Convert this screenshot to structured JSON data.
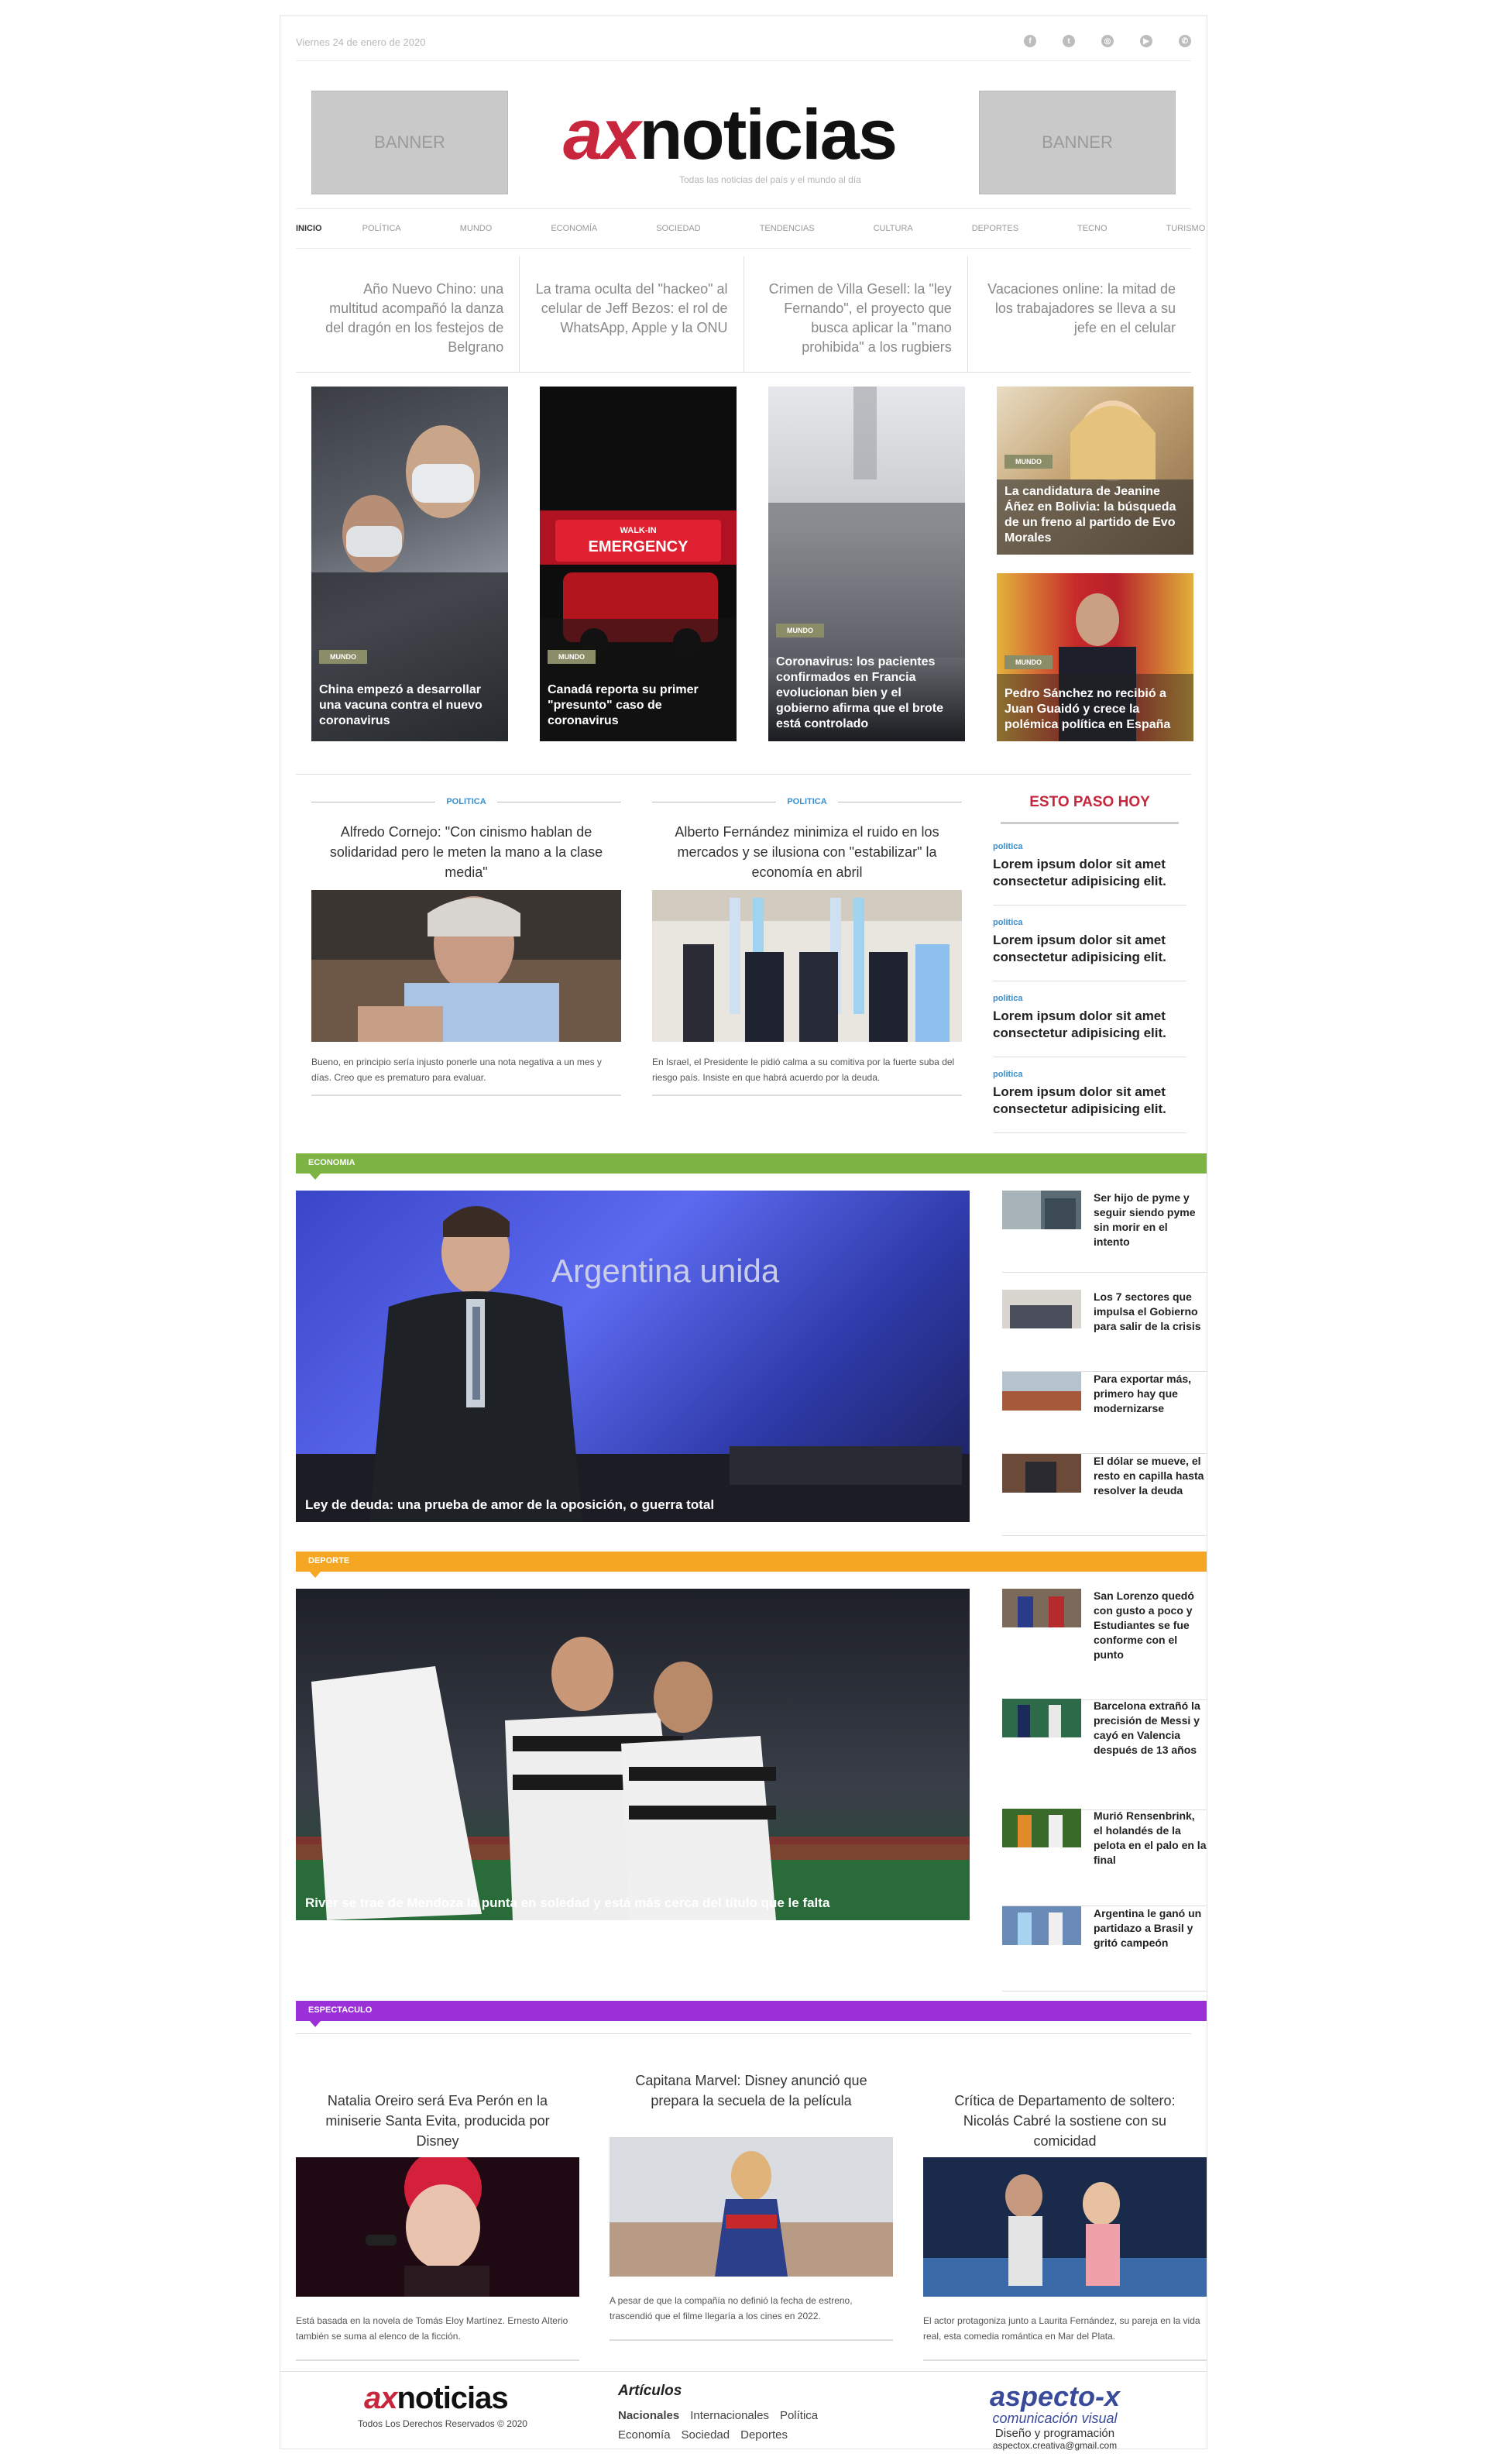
{
  "topbar": {
    "date": "Viernes 24 de enero de 2020",
    "socials": [
      {
        "icon": "facebook-icon",
        "glyph": "f"
      },
      {
        "icon": "twitter-icon",
        "glyph": "t"
      },
      {
        "icon": "instagram-icon",
        "glyph": "◎"
      },
      {
        "icon": "youtube-icon",
        "glyph": "▶"
      },
      {
        "icon": "whatsapp-icon",
        "glyph": "✆"
      }
    ]
  },
  "header": {
    "banner_left": "BANNER",
    "banner_right": "BANNER",
    "logo_ax": "ax",
    "logo_noticias": "noticias",
    "tagline": "Todas las noticias del país y el mundo al día"
  },
  "nav": [
    "INICIO",
    "POLÍTICA",
    "MUNDO",
    "ECONOMÍA",
    "SOCIEDAD",
    "TENDENCIAS",
    "CULTURA",
    "DEPORTES",
    "TECNO",
    "TURISMO"
  ],
  "headlines": [
    "Año Nuevo Chino: una multitud acompañó la danza del dragón en los festejos de Belgrano",
    "La trama oculta del \"hackeo\" al celular de Jeff Bezos: el rol de WhatsApp, Apple y la ONU",
    "Crimen de Villa Gesell: la \"ley Fernando\", el proyecto que busca aplicar la \"mano prohibida\" a los rugbiers",
    "Vacaciones online: la mitad de los trabajadores se lleva a su jefe en el celular"
  ],
  "featured": [
    {
      "category": "MUNDO",
      "title": "China empezó a desarrollar una vacuna contra el nuevo coronavirus"
    },
    {
      "category": "MUNDO",
      "title": "Canadá reporta su primer \"presunto\" caso de coronavirus"
    },
    {
      "category": "MUNDO",
      "title": "Coronavirus: los pacientes confirmados en Francia evolucionan bien y el gobierno afirma que el brote está controlado"
    },
    {
      "category": "MUNDO",
      "title": "La candidatura de Jeanine Áñez en Bolivia: la búsqueda de un freno al partido de Evo Morales"
    },
    {
      "category": "MUNDO",
      "title": "Pedro Sánchez no recibió a Juan Guaidó y crece la polémica política en España"
    }
  ],
  "emergency_sign": {
    "line1": "WALK-IN",
    "line2": "EMERGENCY"
  },
  "politica": [
    {
      "kicker": "POLITICA",
      "title": "Alfredo Cornejo: \"Con cinismo hablan de solidaridad pero le meten la mano a la clase media\"",
      "desc": "Bueno, en principio sería injusto ponerle una nota negativa a un mes y días. Creo que es prematuro para evaluar."
    },
    {
      "kicker": "POLITICA",
      "title": "Alberto Fernández minimiza el ruido en los mercados y se ilusiona con \"estabilizar\" la economía en abril",
      "desc": "En Israel, el Presidente le pidió calma a su comitiva por la fuerte suba del riesgo país. Insiste en que habrá acuerdo por la deuda."
    }
  ],
  "esto_paso_hoy": {
    "title": "ESTO PASO HOY",
    "items": [
      {
        "category": "politica",
        "text": "Lorem ipsum dolor sit amet consectetur adipisicing elit."
      },
      {
        "category": "politica",
        "text": "Lorem ipsum dolor sit amet consectetur adipisicing elit."
      },
      {
        "category": "politica",
        "text": "Lorem ipsum dolor sit amet consectetur adipisicing elit."
      },
      {
        "category": "politica",
        "text": "Lorem ipsum dolor sit amet consectetur adipisicing elit."
      }
    ]
  },
  "economia": {
    "label": "ECONOMIA",
    "color": "#7cb342",
    "main_caption": "Ley de deuda: una prueba de amor de la oposición, o guerra total",
    "screen_text": "Argentina unida",
    "items": [
      "Ser hijo de pyme y seguir siendo pyme sin morir en el intento",
      "Los 7 sectores que impulsa el Gobierno para salir de la crisis",
      "Para exportar más, primero hay que modernizarse",
      "El dólar se mueve, el resto en capilla hasta resolver la deuda"
    ]
  },
  "deporte": {
    "label": "DEPORTE",
    "color": "#f5a623",
    "main_caption": "River se trae de Mendoza la punta en soledad y está más cerca del título que le falta",
    "items": [
      "San Lorenzo quedó con gusto a poco y Estudiantes se fue conforme con el punto",
      "Barcelona extrañó la precisión de Messi y cayó en Valencia después de 13 años",
      "Murió Rensenbrink, el holandés de la pelota en el palo en la final",
      "Argentina le ganó un partidazo a Brasil y gritó campeón"
    ]
  },
  "espectaculo": {
    "label": "ESPECTACULO",
    "color": "#9b30d9",
    "items": [
      {
        "title": "Natalia Oreiro será Eva Perón en la miniserie Santa Evita, producida por Disney",
        "desc": "Está basada en la novela de Tomás Eloy Martínez. Ernesto Alterio también se suma al elenco de la ficción."
      },
      {
        "title": "Capitana Marvel: Disney anunció que prepara la secuela de la película",
        "desc": "A pesar de que la compañía no definió la fecha de estreno, trascendió que el filme llegaría a los cines en 2022."
      },
      {
        "title": "Crítica de Departamento de soltero: Nicolás Cabré la sostiene con su comicidad",
        "desc": "El actor protagoniza junto a Laurita Fernández, su pareja en la vida real, esta comedia romántica en Mar del Plata."
      }
    ]
  },
  "footer": {
    "logo_ax": "ax",
    "logo_noticias": "noticias",
    "copyright": "Todos Los Derechos Reservados © 2020",
    "articles_title": "Artículos",
    "links": [
      "Nacionales",
      "Internacionales",
      "Política",
      "Economía",
      "Sociedad",
      "Deportes"
    ],
    "brand_name": "aspecto-x",
    "brand_sub": "comunicación visual",
    "brand_service": "Diseño y programación",
    "brand_email": "aspectox.creativa@gmail.com"
  }
}
